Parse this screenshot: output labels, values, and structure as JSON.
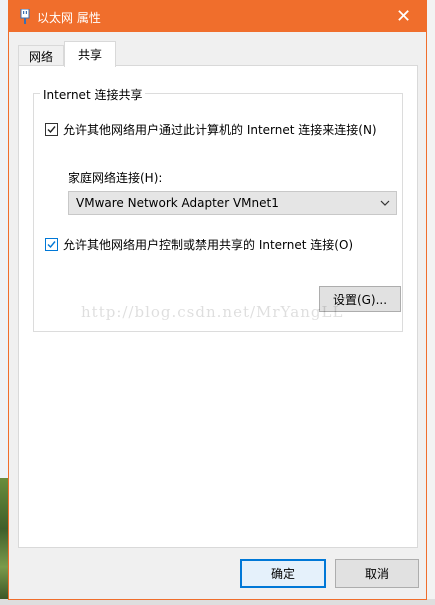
{
  "window": {
    "title": "以太网 属性",
    "close_glyph": "✕",
    "accent_color": "#f06e2c"
  },
  "tabs": [
    {
      "label": "网络",
      "selected": false
    },
    {
      "label": "共享",
      "selected": true
    }
  ],
  "sharing": {
    "group_title": "Internet 连接共享",
    "allow_share_label": "允许其他网络用户通过此计算机的 Internet 连接来连接(N)",
    "allow_share_checked": true,
    "home_network_label": "家庭网络连接(H):",
    "home_network_value": "VMware Network Adapter VMnet1",
    "allow_control_label": "允许其他网络用户控制或禁用共享的 Internet 连接(O)",
    "allow_control_checked": true,
    "settings_button": "设置(G)..."
  },
  "watermark": "http://blog.csdn.net/MrYangLL",
  "footer": {
    "ok_label": "确定",
    "cancel_label": "取消"
  }
}
